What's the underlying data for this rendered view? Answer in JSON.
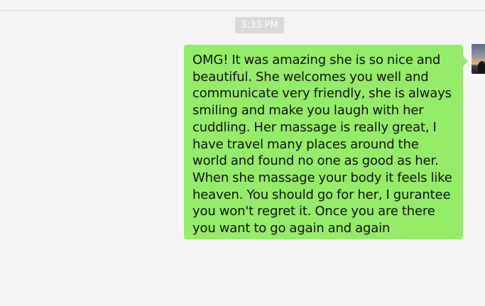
{
  "chat": {
    "timestamp": "3:33 PM",
    "message": {
      "text": "OMG! It was amazing she is so nice and beautiful. She welcomes you well and communicate very friendly, she is always smiling and make you laugh with her cuddling. Her massage is really great, I have travel many places around the world and found no one as good as her. When she massage your body it feels like heaven. You should go for her, I gurantee you won't regret it. Once you are there you want to go again and again",
      "sender": "self",
      "bubble_color": "#95ec69"
    },
    "background_color": "#f5f5f5"
  }
}
